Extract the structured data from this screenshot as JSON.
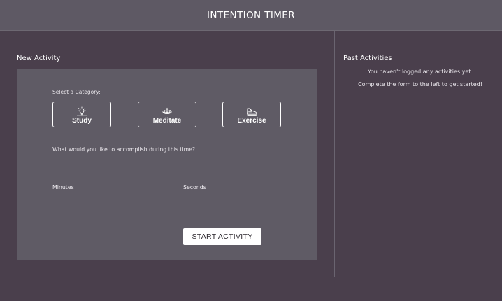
{
  "header": {
    "title": "INTENTION TIMER"
  },
  "new_activity": {
    "title": "New Activity",
    "category_label": "Select a Category:",
    "categories": [
      {
        "label": "Study",
        "icon": "lightbulb-icon"
      },
      {
        "label": "Meditate",
        "icon": "lotus-icon"
      },
      {
        "label": "Exercise",
        "icon": "shoe-icon"
      }
    ],
    "description_label": "What would you like to accomplish during this time?",
    "description_value": "",
    "minutes_label": "Minutes",
    "minutes_value": "",
    "seconds_label": "Seconds",
    "seconds_value": "",
    "start_button": "START ACTIVITY"
  },
  "past_activities": {
    "title": "Past Activities",
    "empty_line1": "You haven't logged any activities yet.",
    "empty_line2": "Complete the form to the left to get started!"
  },
  "colors": {
    "background": "#4a3f4c",
    "header": "#5e5964",
    "card": "#5f5b65",
    "text": "#ffffff"
  }
}
